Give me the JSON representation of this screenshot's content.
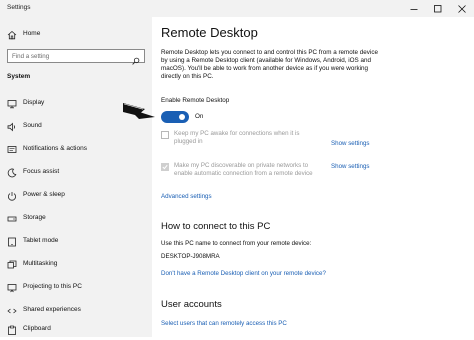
{
  "window": {
    "title": "Settings",
    "controls": [
      "minimize",
      "maximize",
      "close"
    ]
  },
  "sidebar": {
    "home_label": "Home",
    "search_placeholder": "Find a setting",
    "section_label": "System",
    "items": [
      {
        "label": "Display",
        "icon": "display-icon"
      },
      {
        "label": "Sound",
        "icon": "sound-icon"
      },
      {
        "label": "Notifications & actions",
        "icon": "notifications-icon"
      },
      {
        "label": "Focus assist",
        "icon": "focus-assist-icon"
      },
      {
        "label": "Power & sleep",
        "icon": "power-icon"
      },
      {
        "label": "Storage",
        "icon": "storage-icon"
      },
      {
        "label": "Tablet mode",
        "icon": "tablet-icon"
      },
      {
        "label": "Multitasking",
        "icon": "multitasking-icon"
      },
      {
        "label": "Projecting to this PC",
        "icon": "projecting-icon"
      },
      {
        "label": "Shared experiences",
        "icon": "shared-experiences-icon"
      },
      {
        "label": "Clipboard",
        "icon": "clipboard-icon"
      }
    ]
  },
  "main": {
    "title": "Remote Desktop",
    "description": "Remote Desktop lets you connect to and control this PC from a remote device by using a Remote Desktop client (available for Windows, Android, iOS and macOS). You'll be able to work from another device as if you were working directly on this PC.",
    "enable_label": "Enable Remote Desktop",
    "toggle_state": "On",
    "toggle_on": true,
    "options": [
      {
        "line1": "Keep my PC awake for connections when it is",
        "line2": "plugged in",
        "checked": false,
        "link": "Show settings"
      },
      {
        "line1": "Make my PC discoverable on private networks to",
        "line2": "enable automatic connection from a remote device",
        "checked": true,
        "link": "Show settings"
      }
    ],
    "advanced_settings": "Advanced settings",
    "connect_heading": "How to connect to this PC",
    "connect_instruction": "Use this PC name to connect from your remote device:",
    "pc_name": "DESKTOP-J908MRA",
    "no_client_link": "Don't have a Remote Desktop client on your remote device?",
    "accounts_heading": "User accounts",
    "select_users_link": "Select users that can remotely access this PC"
  },
  "colors": {
    "accent": "#1a5fb4",
    "sidebar_bg": "#f2f2f2",
    "disabled_text": "#9a9a9a"
  }
}
